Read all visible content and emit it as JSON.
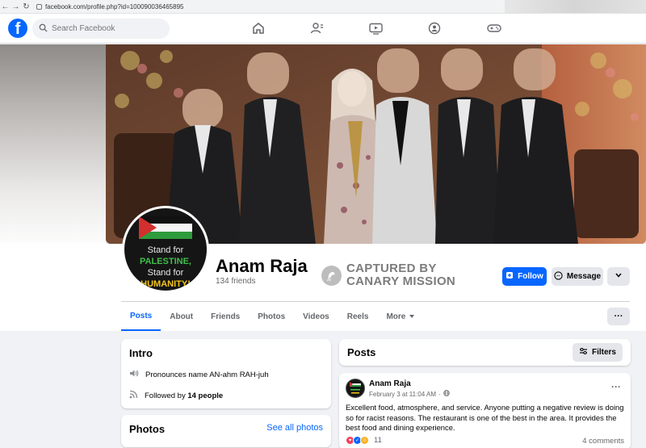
{
  "browser": {
    "url": "facebook.com/profile.php?id=100090036465895"
  },
  "topbar": {
    "logo": "f",
    "search_placeholder": "Search Facebook",
    "nav_icons": [
      "home-icon",
      "friends-icon",
      "video-icon",
      "groups-icon",
      "gaming-icon"
    ]
  },
  "profile": {
    "name": "Anam Raja",
    "friends": "134 friends",
    "avatar_text": {
      "line1": "Stand for",
      "line2": "PALESTINE,",
      "line3": "Stand for",
      "line4": "HUMANITY!"
    }
  },
  "watermark": {
    "line1": "CAPTURED BY",
    "line2": "CANARY MISSION"
  },
  "actions": {
    "follow": "Follow",
    "message": "Message"
  },
  "tabs": [
    {
      "label": "Posts",
      "active": true
    },
    {
      "label": "About"
    },
    {
      "label": "Friends"
    },
    {
      "label": "Photos"
    },
    {
      "label": "Videos"
    },
    {
      "label": "Reels"
    },
    {
      "label": "More"
    }
  ],
  "intro": {
    "title": "Intro",
    "pronounce": "Pronounces name AN-ahm RAH-juh",
    "followed_prefix": "Followed by ",
    "followed_count": "14 people"
  },
  "photos_card": {
    "title": "Photos",
    "see_all": "See all photos"
  },
  "posts_card": {
    "title": "Posts",
    "filters": "Filters"
  },
  "post": {
    "author": "Anam Raja",
    "date": "February 3 at 11:04 AM",
    "dot": "·",
    "text": "Excellent food, atmosphere, and service. Anyone putting a negative review is doing so for racist reasons. The restaurant is one of the best in the area. It provides the best food and dining experience.",
    "reaction_count": "11",
    "comments": "4 comments"
  },
  "colors": {
    "brand": "#0866ff",
    "flag_red": "#d32f2f",
    "flag_green": "#2e9b3c"
  }
}
